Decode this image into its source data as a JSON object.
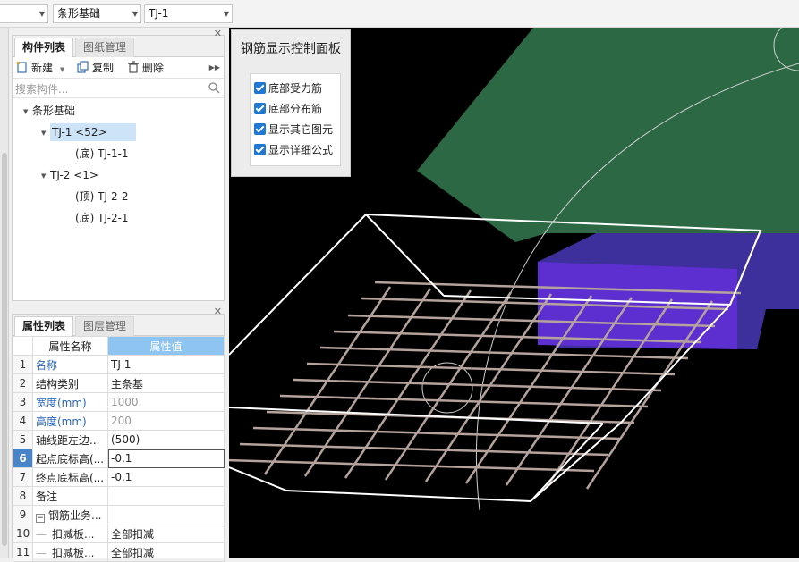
{
  "topbar": {
    "combo1": "",
    "combo2": "条形基础",
    "combo3": "TJ-1"
  },
  "component_panel": {
    "tab_active": "构件列表",
    "tab_inactive": "图纸管理",
    "new_label": "新建",
    "copy_label": "复制",
    "delete_label": "删除",
    "search_placeholder": "搜索构件...",
    "tree": {
      "root": "条形基础",
      "node1": "TJ-1 <52>",
      "node1_child": "(底)  TJ-1-1",
      "node2": "TJ-2 <1>",
      "node2_child1": "(顶)  TJ-2-2",
      "node2_child2": "(底)  TJ-2-1"
    }
  },
  "property_panel": {
    "tab_active": "属性列表",
    "tab_inactive": "图层管理",
    "header_name": "属性名称",
    "header_value": "属性值",
    "rows": [
      {
        "num": "1",
        "name": "名称",
        "value": "TJ-1"
      },
      {
        "num": "2",
        "name": "结构类别",
        "value": "主条基"
      },
      {
        "num": "3",
        "name": "宽度(mm)",
        "value": "1000"
      },
      {
        "num": "4",
        "name": "高度(mm)",
        "value": "200"
      },
      {
        "num": "5",
        "name": "轴线距左边...",
        "value": "(500)"
      },
      {
        "num": "6",
        "name": "起点底标高(...",
        "value": "-0.1"
      },
      {
        "num": "7",
        "name": "终点底标高(...",
        "value": "-0.1"
      },
      {
        "num": "8",
        "name": "备注",
        "value": ""
      },
      {
        "num": "9",
        "name": "钢筋业务...",
        "value": ""
      },
      {
        "num": "10",
        "name": "扣减板...",
        "value": "全部扣减"
      },
      {
        "num": "11",
        "name": "扣减板...",
        "value": "全部扣减"
      }
    ]
  },
  "control_panel": {
    "title": "钢筋显示控制面板",
    "options": [
      "底部受力筋",
      "底部分布筋",
      "显示其它图元",
      "显示详细公式"
    ]
  },
  "colors": {
    "accent": "#8ec4f2",
    "selection": "#cde3f8",
    "checkbox": "#1e78d4"
  }
}
